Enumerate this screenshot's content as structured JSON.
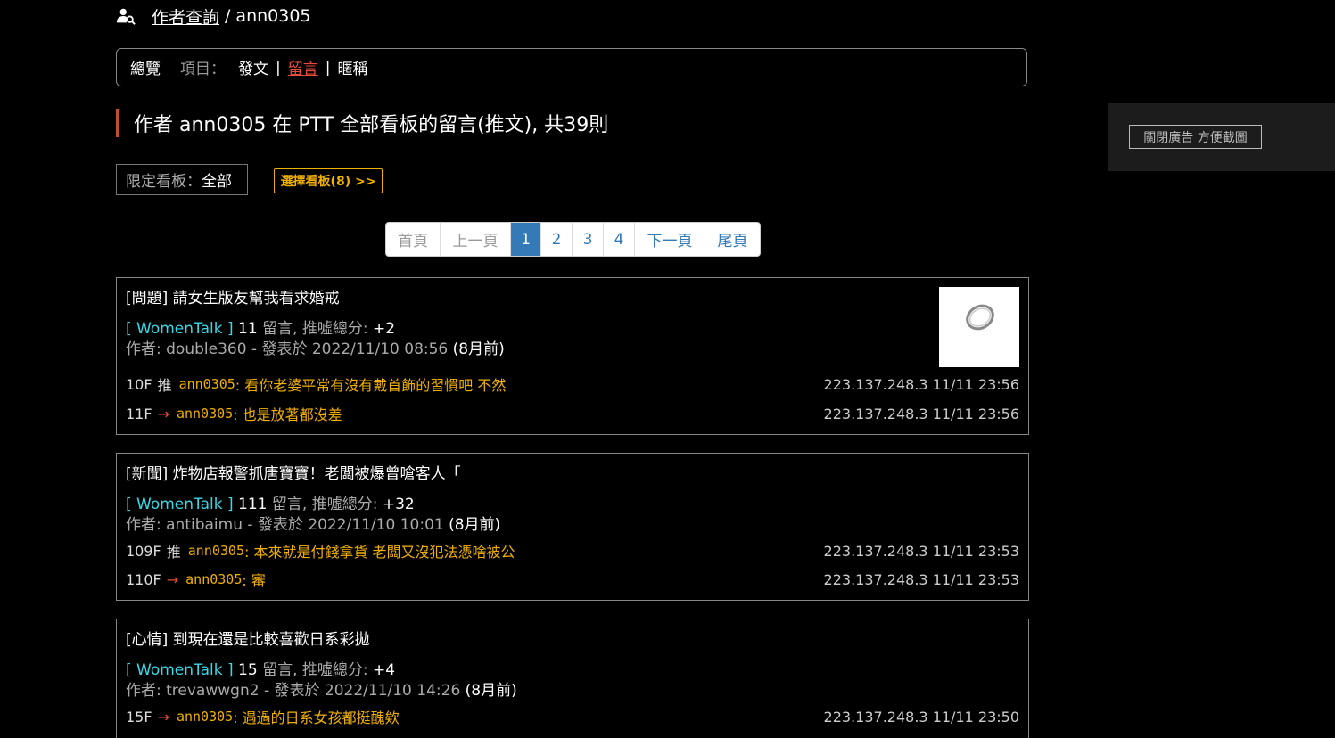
{
  "header": {
    "link": "作者查詢",
    "sep": "/",
    "username": "ann0305"
  },
  "tabs": {
    "overview": "總覽",
    "label": "項目：",
    "items": [
      "發文",
      "留言",
      "暱稱"
    ],
    "bar": "|"
  },
  "title": "作者 ann0305 在 PTT 全部看板的留言(推文), 共39則",
  "board_limit": {
    "label": "限定看板：",
    "value": "全部"
  },
  "choose_board": "選擇看板(8) >>",
  "pagination": {
    "first": "首頁",
    "prev": "上一頁",
    "pages": [
      "1",
      "2",
      "3",
      "4"
    ],
    "next": "下一頁",
    "last": "尾頁"
  },
  "posts": [
    {
      "title": "[問題] 請女生版友幫我看求婚戒",
      "board": "[ WomenTalk ]",
      "reply_count": "11",
      "reply_label": " 留言, 推噓總分: ",
      "score": "+2",
      "author_line": "作者: double360 - 發表於 2022/11/10 08:56 ",
      "ago": "(8月前)",
      "comments": [
        {
          "floor": "10F",
          "tag": "推",
          "uid": "ann0305",
          "content": ": 看你老婆平常有沒有戴首飾的習慣吧 不然",
          "ipdt": "223.137.248.3 11/11 23:56"
        },
        {
          "floor": "11F",
          "tag": "→",
          "uid": "ann0305",
          "content": ": 也是放著都沒差",
          "ipdt": "223.137.248.3 11/11 23:56"
        }
      ]
    },
    {
      "title": "[新聞] 炸物店報警抓唐寶寶！老闆被爆曾嗆客人「",
      "board": "[ WomenTalk ]",
      "reply_count": "111",
      "reply_label": " 留言, 推噓總分: ",
      "score": "+32",
      "author_line": "作者: antibaimu - 發表於 2022/11/10 10:01 ",
      "ago": "(8月前)",
      "comments": [
        {
          "floor": "109F",
          "tag": "推",
          "uid": "ann0305",
          "content": ": 本來就是付錢拿貨 老闆又沒犯法憑啥被公",
          "ipdt": "223.137.248.3 11/11 23:53"
        },
        {
          "floor": "110F",
          "tag": "→",
          "uid": "ann0305",
          "content": ": 審",
          "ipdt": "223.137.248.3 11/11 23:53"
        }
      ]
    },
    {
      "title": "[心情] 到現在還是比較喜歡日系彩拋",
      "board": "[ WomenTalk ]",
      "reply_count": "15",
      "reply_label": " 留言, 推噓總分: ",
      "score": "+4",
      "author_line": "作者: trevawwgn2 - 發表於 2022/11/10 14:26 ",
      "ago": "(8月前)",
      "comments": [
        {
          "floor": "15F",
          "tag": "→",
          "uid": "ann0305",
          "content": ": 遇過的日系女孩都挺醜欸",
          "ipdt": "223.137.248.3 11/11 23:50"
        }
      ]
    }
  ],
  "side_panel": {
    "close_ad": "關閉廣告 方便截圖"
  },
  "colors": {
    "accent_red": "#e84c3d",
    "board_cyan": "#3cd7e6",
    "comment_yellow": "#f0b000",
    "page_blue": "#337ab7"
  }
}
